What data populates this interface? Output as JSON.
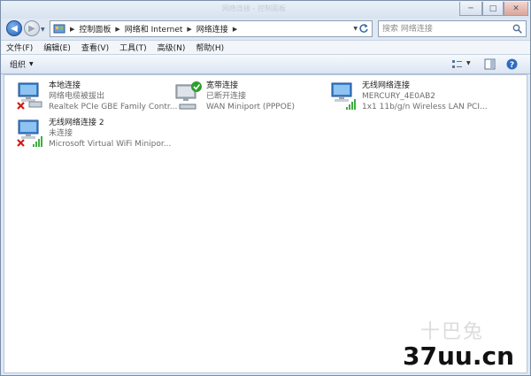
{
  "titlebar": {
    "ghost_text": "网络连接 - 控制面板"
  },
  "window_controls": {
    "minimize": "─",
    "maximize": "□",
    "close": "✕"
  },
  "nav": {
    "back": "◀",
    "forward": "▶",
    "breadcrumbs": [
      "控制面板",
      "网络和 Internet",
      "网络连接"
    ],
    "search_placeholder": "搜索 网络连接"
  },
  "menu": [
    "文件(F)",
    "编辑(E)",
    "查看(V)",
    "工具(T)",
    "高级(N)",
    "帮助(H)"
  ],
  "toolbar": {
    "organize_label": "组织"
  },
  "connections": [
    {
      "name": "本地连接",
      "status": "网络电缆被拔出",
      "device": "Realtek PCIe GBE Family Contr...",
      "icon": "wired-disconnected-icon"
    },
    {
      "name": "宽带连接",
      "status": "已断开连接",
      "device": "WAN Miniport (PPPOE)",
      "icon": "broadband-icon"
    },
    {
      "name": "无线网络连接",
      "status": "MERCURY_4E0AB2",
      "device": "1x1 11b/g/n Wireless LAN PCI...",
      "icon": "wireless-connected-icon"
    },
    {
      "name": "无线网络连接 2",
      "status": "未连接",
      "device": "Microsoft Virtual WiFi Minipor...",
      "icon": "wireless-disconnected-icon"
    }
  ],
  "watermark": {
    "faint": "十巴兔",
    "text": "37uu.cn"
  },
  "colors": {
    "accent": "#1f5fb8",
    "error": "#d11a1a",
    "ok": "#2f9e2f"
  }
}
